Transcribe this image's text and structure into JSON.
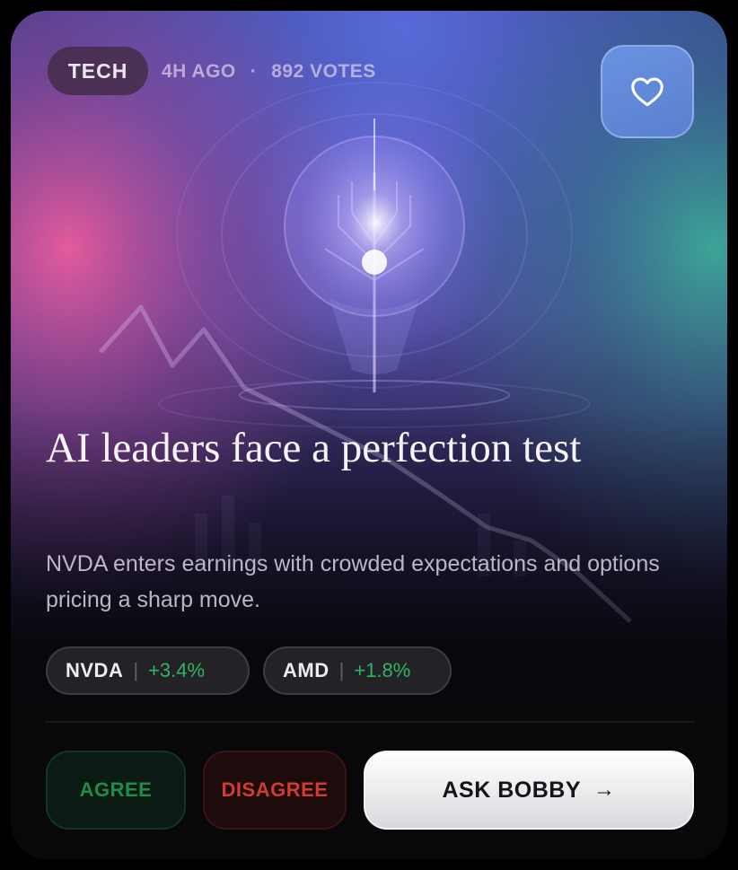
{
  "card": {
    "tag": "TECH",
    "time_ago": "4H AGO",
    "separator": "·",
    "votes": "892 VOTES",
    "favorite_icon": "heart-outline-icon",
    "headline": "AI leaders face a perfection test",
    "subtitle": "NVDA enters earnings with crowded expectations and options pricing a sharp move."
  },
  "tickers": [
    {
      "symbol": "NVDA",
      "separator": "|",
      "change": "+3.4%"
    },
    {
      "symbol": "AMD",
      "separator": "|",
      "change": "+1.8%"
    }
  ],
  "actions": {
    "agree": "AGREE",
    "disagree": "DISAGREE",
    "ask": "ASK BOBBY",
    "ask_arrow": "→"
  },
  "colors": {
    "positive": "#2fb45f",
    "agree_text": "#1f8c4a",
    "disagree_text": "#d23b32",
    "favorite_button": "#6e96e6"
  }
}
